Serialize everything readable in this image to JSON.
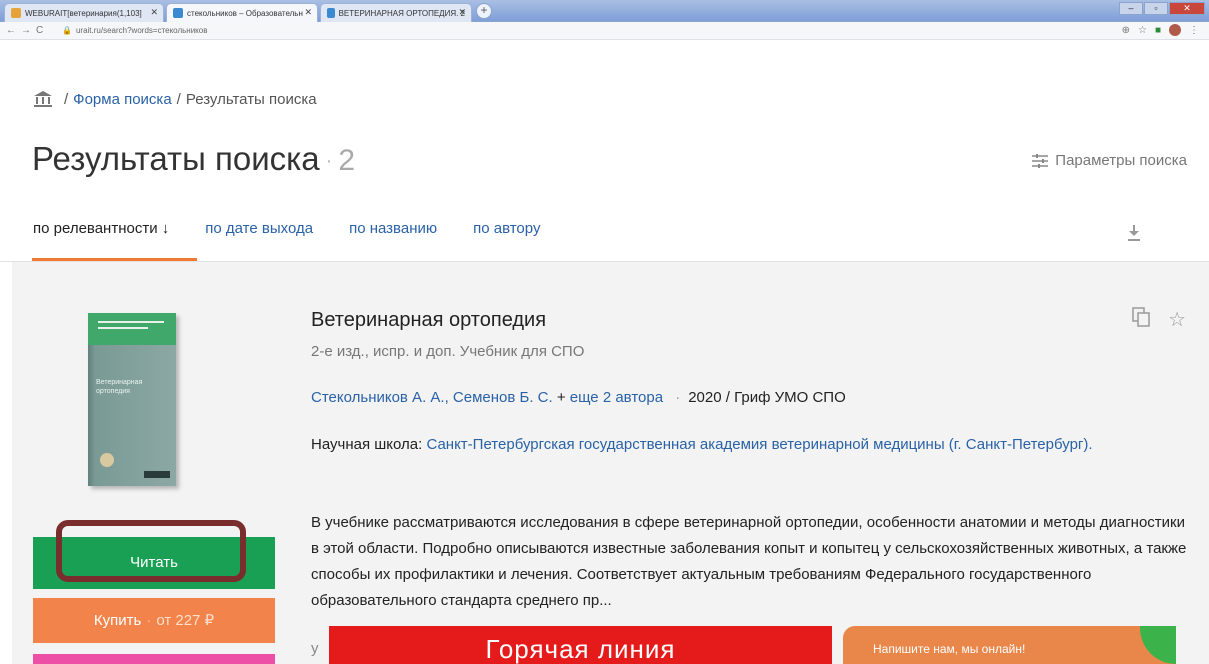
{
  "browser": {
    "tabs": [
      {
        "label": "WEBURAIT[ветеринария(1,103]"
      },
      {
        "label": "стекольников – Образовательн"
      },
      {
        "label": "ВЕТЕРИНАРНАЯ ОРТОПЕДИЯ. 2"
      }
    ],
    "new_tab": "+",
    "url": "urait.ru/search?words=стекольников"
  },
  "breadcrumb": {
    "sep": "/",
    "form": "Форма поиска",
    "current": "Результаты поиска"
  },
  "header": {
    "title": "Результаты поиска",
    "count": "2",
    "params_label": "Параметры поиска"
  },
  "sort": {
    "relevance": "по релевантности ↓",
    "date": "по дате выхода",
    "name": "по названию",
    "author": "по автору"
  },
  "book": {
    "cover_title": "Ветеринарная ортопедия",
    "title": "Ветеринарная ортопедия",
    "subtitle": "2-е изд., испр. и доп. Учебник для СПО",
    "authors": "Стекольников А. А., Семенов Б. С.",
    "plus": "+",
    "more_authors": "еще 2 автора",
    "dot": "·",
    "year": "2020",
    "grif": "/ Гриф УМО СПО",
    "school_label": "Научная школа:",
    "school_link": "Санкт-Петербургская государственная академия ветеринарной медицины (г. Санкт-Петербург).",
    "description": "В учебнике рассматриваются исследования в сфере ветеринарной ортопедии, особенности анатомии и методы диагностики в этой области. Подробно описываются известные заболевания копыт и копытец у сельскохозяйственных животных, а также способы их профилактики и лечения. Соответствует актуальным требованиям Федерального государственного образовательного стандарта среднего пр...",
    "read_label": "Читать",
    "buy_label": "Купить",
    "buy_sep": "·",
    "buy_price": "от 227 ₽",
    "fragment": "у"
  },
  "overlay": {
    "hotline": "Горячая линия",
    "chat": "Напишите нам, мы онлайн!"
  },
  "colors": {
    "link": "#2a62a8",
    "read_button": "#1aa055",
    "buy_button": "#f2834b",
    "accent_underline": "#f07832",
    "hotline": "#e51b1b"
  }
}
